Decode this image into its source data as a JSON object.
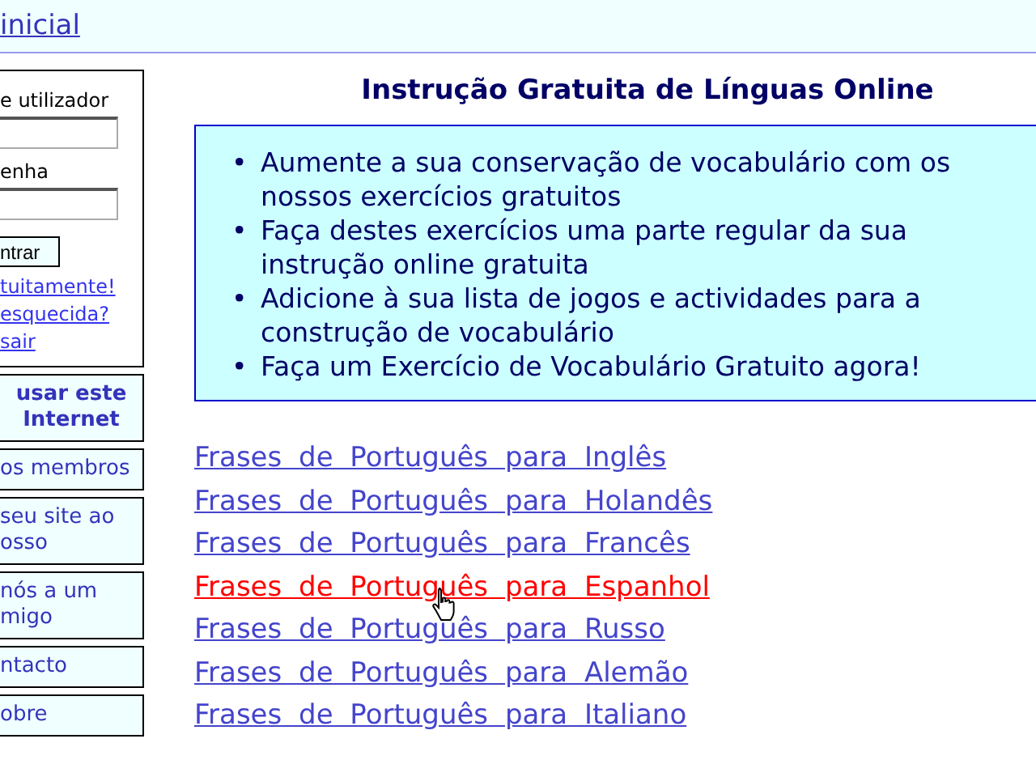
{
  "header": {
    "home_link": "inicial"
  },
  "sidebar": {
    "login": {
      "username_label": "e utilizador",
      "password_label": "enha",
      "submit_button": "ntrar",
      "links": [
        "tuitamente!",
        "esquecida?",
        "sair"
      ]
    },
    "menu": [
      {
        "lines": [
          "usar este",
          "Internet"
        ],
        "bold": true
      },
      {
        "lines": [
          "os membros"
        ],
        "bold": false
      },
      {
        "lines": [
          "seu site ao",
          "osso"
        ],
        "bold": false
      },
      {
        "lines": [
          "nós a um",
          "migo"
        ],
        "bold": false
      },
      {
        "lines": [
          "ntacto"
        ],
        "bold": false
      },
      {
        "lines": [
          "obre"
        ],
        "bold": false
      }
    ]
  },
  "main": {
    "title": "Instrução Gratuita de Línguas Online",
    "bullets": [
      {
        "marker": "•",
        "text": "Aumente a sua conservação de vocabulário com os nossos exercícios gratuitos"
      },
      {
        "marker": "•",
        "text": "Faça destes exercícios uma parte regular da sua instrução online gratuita"
      },
      {
        "marker": "•",
        "text": "Adicione à sua lista de jogos e actividades para a construção de vocabulário"
      },
      {
        "marker": "•",
        "text": "Faça um Exercício de Vocabulário Gratuito agora!"
      }
    ],
    "links": [
      {
        "label": "Frases de Português para Inglês",
        "hovered": false
      },
      {
        "label": "Frases de Português para Holandês",
        "hovered": false
      },
      {
        "label": "Frases de Português para Francês",
        "hovered": false
      },
      {
        "label": "Frases de Português para Espanhol",
        "hovered": true
      },
      {
        "label": "Frases de Português para Russo",
        "hovered": false
      },
      {
        "label": "Frases de Português para Alemão",
        "hovered": false
      },
      {
        "label": "Frases de Português para Italiano",
        "hovered": false
      }
    ]
  }
}
